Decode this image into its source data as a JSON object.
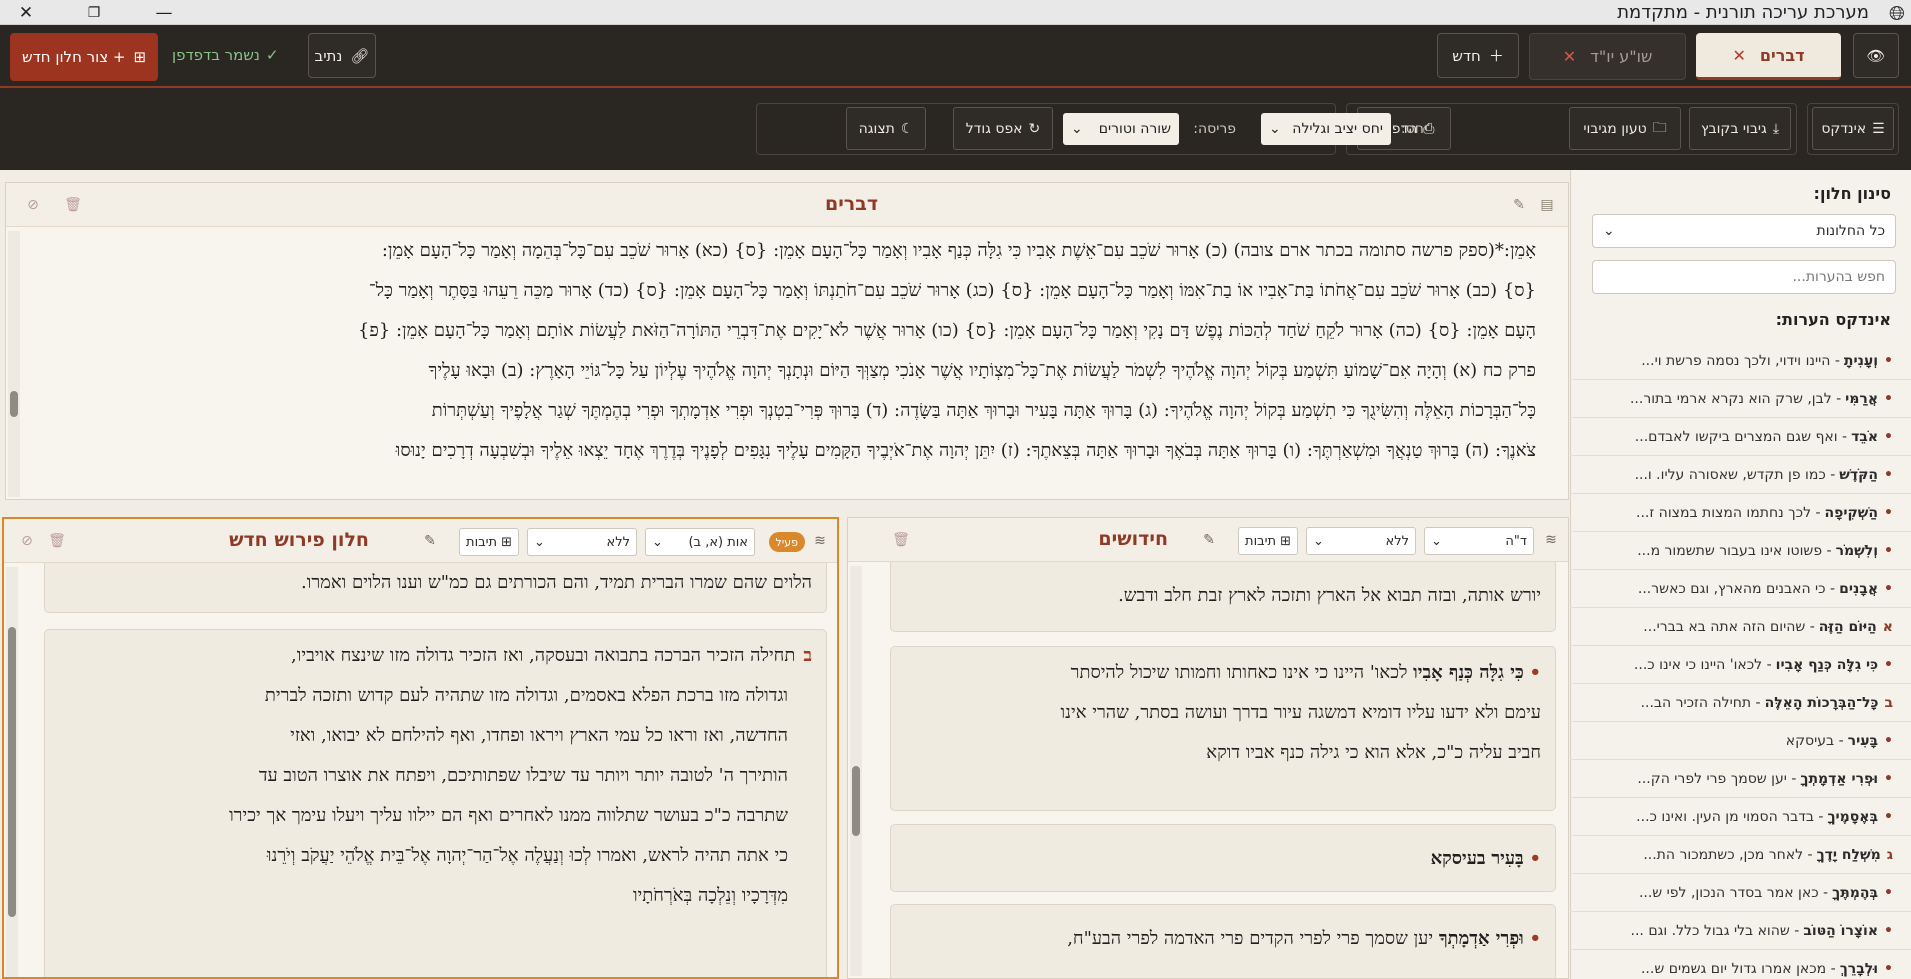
{
  "app": {
    "title": "מערכת עריכה תורנית - מתקדמת"
  },
  "tabbar": {
    "tabs": [
      {
        "label": "דברים"
      },
      {
        "label": "שו\"ע יו\"ד"
      }
    ],
    "new_tab_label": "חדש",
    "path_label": "נתיב",
    "saved_label": "נשמר בדפדפן",
    "new_window_label": "+ צור חלון חדש"
  },
  "toolbar": {
    "index_label": "אינדקס",
    "backup_label": "גיבוי בקובץ",
    "load_backup_label": "טעון מגיבוי",
    "print_label": "הדפסה",
    "relation_label": "יחס:",
    "relation_value": "יחס יציב וגלילה",
    "layout_label": "פריסה:",
    "layout_value": "שורה וטורים",
    "reset_label": "אפס גודל",
    "display_label": "תצוגה"
  },
  "sidebar": {
    "filter_title": "סינון חלון:",
    "filter_value": "כל החלונות",
    "search_placeholder": "חפש בהערות...",
    "index_title": "אינדקס הערות:",
    "items": [
      {
        "dot": "•",
        "head": "וְעָנִיתָ",
        "rest": " - היינו וידוי, ולכך נסמה פרשת וי..."
      },
      {
        "dot": "•",
        "head": "אֲרַמִּי",
        "rest": " - לבן, שרק הוא נקרא ארמי בתור..."
      },
      {
        "dot": "•",
        "head": "אֹבֵד",
        "rest": " - ואף שגם המצרים ביקשו לאבדם..."
      },
      {
        "dot": "•",
        "head": "הַקֹּדֶשׁ",
        "rest": " - כמו פן תקדש, שאסורה עליו. ו..."
      },
      {
        "dot": "•",
        "head": "הַשְׁקִיפָה",
        "rest": " - לכך נחתמו המצות במצוה ז..."
      },
      {
        "dot": "•",
        "head": "וְלִשְׁמֹר",
        "rest": " - פשוטו אינו בעבור שתשמור מ..."
      },
      {
        "dot": "•",
        "head": "אֲבָנִים",
        "rest": " - כי האבנים מהארץ, וגם כאשר..."
      },
      {
        "dot": "א",
        "head": "הַיּוֹם הַזֶּה",
        "rest": " - שהיום הזה אתה בא בברי..."
      },
      {
        "dot": "•",
        "head": "כִּי גִלָּה כְּנַף אָבִיו",
        "rest": " - לכאו' היינו כי אינו כ..."
      },
      {
        "dot": "ב",
        "head": "כָּל־הַבְּרָכוֹת הָאֵלֶּה",
        "rest": " - תחילה הזכיר הב..."
      },
      {
        "dot": "•",
        "head": "בָּעִיר",
        "rest": " - בעיסקא"
      },
      {
        "dot": "•",
        "head": "וּפְרִי אַדְמָתְךָ",
        "rest": " - יען שסמך פרי לפרי הק..."
      },
      {
        "dot": "•",
        "head": "בְּאֶסָמֶיךָ",
        "rest": " - בדבר הסמוי מן העין. ואינו כ..."
      },
      {
        "dot": "ג",
        "head": "מִשְׁלַח יָדֶךָ",
        "rest": " - לאחר מכן, כשתמכור הת..."
      },
      {
        "dot": "•",
        "head": "בְּהֶמְתֶּךָ",
        "rest": " - כאן אמר בסדר הנכון, לפי ש..."
      },
      {
        "dot": "•",
        "head": "אוֹצָרוֹ הַטּוֹב",
        "rest": " - שהוא בלי גבול כלל. וגם ..."
      },
      {
        "dot": "•",
        "head": "וּלְבָרֵךְ",
        "rest": " - מכאן אמרו גדול יום גשמים ש..."
      }
    ]
  },
  "main_panel": {
    "title": "דברים",
    "lines": [
      "אָמֵן:*(ספק פרשה סתומה בכתר ארם צובה) (כ) אָרוּר שֹׁכֵב עִם־אֵשֶׁת אָבִיו כִּי גִלָּה כְּנַף אָבִיו וְאָמַר כָּל־הָעָם אָמֵן: {ס} (כא) אָרוּר שֹׁכֵב עִם־כָּל־בְּהֵמָה וְאָמַר כָּל־הָעָם אָמֵן:",
      "{ס} (כב) אָרוּר שֹׁכֵב עִם־אֲחֹתוֹ בַּת־אָבִיו אוֹ בַת־אִמּוֹ וְאָמַר כָּל־הָעָם אָמֵן: {ס} (כג) אָרוּר שֹׁכֵב עִם־חֹתַנְתּוֹ וְאָמַר כָּל־הָעָם אָמֵן: {ס} (כד) אָרוּר מַכֵּה רֵעֵהוּ בַּסָּתֶר וְאָמַר כָּל־",
      "הָעָם אָמֵן: {ס} (כה) אָרוּר לֹקֵחַ שֹׁחַד לְהַכּוֹת נֶפֶשׁ דָּם נָקִי וְאָמַר כָּל־הָעָם אָמֵן: {ס} (כו) אָרוּר אֲשֶׁר לֹא־יָקִים אֶת־דִּבְרֵי הַתּוֹרָה־הַזֹּאת לַעֲשׂוֹת אוֹתָם וְאָמַר כָּל־הָעָם אָמֵן: {פ}",
      "פרק כח (א) וְהָיָה אִם־שָׁמוֹעַ תִּשְׁמַע בְּקוֹל יְהוָה אֱלֹהֶיךָ לִשְׁמֹר לַעֲשׂוֹת אֶת־כָּל־מִצְוֹתָיו אֲשֶׁר אָנֹכִי מְצַוְּךָ הַיּוֹם וּנְתָנְךָ יְהוָה אֱלֹהֶיךָ עֶלְיוֹן עַל כָּל־גּוֹיֵי הָאָרֶץ: (ב) וּבָאוּ עָלֶיךָ",
      "כָּל־הַבְּרָכוֹת הָאֵלֶּה וְהִשִּׂיגֻךָ כִּי תִשְׁמַע בְּקוֹל יְהוָה אֱלֹהֶיךָ: (ג) בָּרוּךְ אַתָּה בָּעִיר וּבָרוּךְ אַתָּה בַּשָּׂדֶה: (ד) בָּרוּךְ פְּרִי־בִטְנְךָ וּפְרִי אַדְמָתְךָ וּפְרִי בְהֶמְתֶּךָ שְׁגַר אֲלָפֶיךָ וְעַשְׁתְּרוֹת",
      "צֹאנֶךָ: (ה) בָּרוּךְ טַנְאֲךָ וּמִשְׁאַרְתֶּךָ: (ו) בָּרוּךְ אַתָּה בְּבֹאֶךָ וּבָרוּךְ אַתָּה בְּצֵאתֶךָ: (ז) יִתֵּן יְהוָה אֶת־אֹיְבֶיךָ הַקָּמִים עָלֶיךָ נִגָּפִים לְפָנֶיךָ בְּדֶרֶךְ אֶחָד יֵצְאוּ אֵלֶיךָ וּבְשִׁבְעָה דְרָכִים יָנוּסוּ"
    ]
  },
  "left_panel": {
    "title": "חלון פירוש חדש",
    "badge": "פעיל",
    "letter_select": "אות (א, ב)",
    "style_select": "ללא",
    "boxes_label": "תיבות",
    "top_card_text": "הלוים שהם שמרו הברית תמיד, והם הכורתים גם כמ\"ש וענו הלוים ואמרו.",
    "card_letter": "ב",
    "card_lines": [
      "תחילה הזכיר הברכה בתבואה ובעסקה, ואז הזכיר גדולה מזו שינצח אויביו,",
      "וגדולה מזו ברכת הפלא באסמים, וגדולה מזו שתהיה לעם קדוש ותזכה לברית",
      "החדשה, ואז וראו כל עמי הארץ ויראו ופחדו, ואף להילחם לא יבואו, ואזי",
      "הותירך ה' לטובה יותר ויותר עד שיבלו שפתותיכם, ויפתח את אוצרו הטוב עד",
      "שתרבה כ\"כ בעושר שתלווה ממנו לאחרים ואף הם יילוו עליך ויעלו עימך אך יכירו",
      "כי אתה תהיה לראש, ואמרו לְכוּ וְנַעֲלֶה אֶל־הַר־יְהוָה אֶל־בֵּית אֱלֹהֵי יַעֲקֹב וְיֹרֵנוּ",
      "מִדְּרָכָיו וְנֵלְכָה בְּאֹרְחֹתָיו"
    ]
  },
  "right_panel": {
    "title": "חידושים",
    "letter_select": "ד\"ה",
    "style_select": "ללא",
    "boxes_label": "תיבות",
    "top_card_text": "יורש אותה, ובזה תבוא אל הארץ ותזכה לארץ זבת חלב ודבש.",
    "card1_head": "כִּי גִלָּה כְּנַף אָבִיו",
    "card1_lines": [
      "לכאו' היינו כי אינו כאחותו וחמותו שיכול להיסתר",
      "עימם ולא ידעו עליו דומיא דמשגה עיור בדרך ועושה בסתר, שהרי אינו",
      "חביב עליה כ\"כ, אלא הוא כי גילה כנף אביו דוקא"
    ],
    "card2_head": "בָּעִיר",
    "card2_rest": "בעיסקא",
    "card3_head": "וּפְרִי אַדְמָתְךָ",
    "card3_rest": "יען שסמך פרי לפרי הקדים פרי האדמה לפרי הבע\"ח,"
  }
}
